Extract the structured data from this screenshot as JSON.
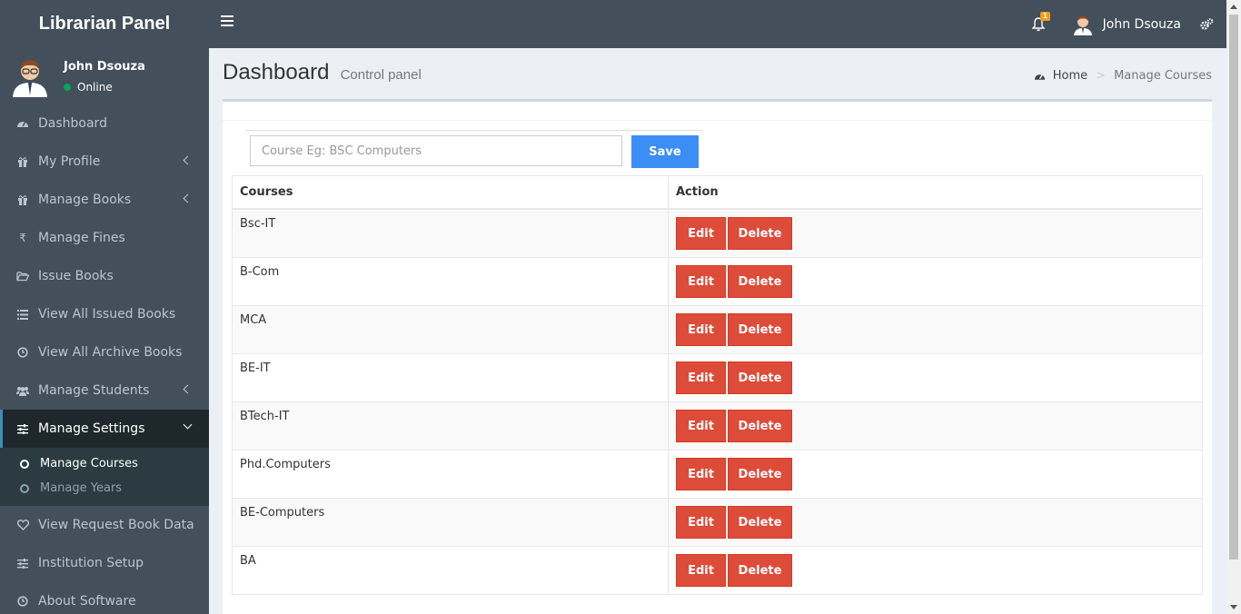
{
  "app": {
    "title": "Librarian Panel"
  },
  "header": {
    "notification_count": "1",
    "user_name": "John Dsouza"
  },
  "sidebar": {
    "user": {
      "name": "John Dsouza",
      "status": "Online"
    },
    "items": [
      {
        "label": "Dashboard",
        "icon": "dashboard-icon"
      },
      {
        "label": "My Profile",
        "icon": "gift-icon"
      },
      {
        "label": "Manage Books",
        "icon": "gift-icon"
      },
      {
        "label": "Manage Fines",
        "icon": "rupee-icon"
      },
      {
        "label": "Issue Books",
        "icon": "folder-open-icon"
      },
      {
        "label": "View All Issued Books",
        "icon": "list-icon"
      },
      {
        "label": "View All Archive Books",
        "icon": "clock-icon"
      },
      {
        "label": "Manage Students",
        "icon": "users-icon"
      },
      {
        "label": "Manage Settings",
        "icon": "sliders-icon"
      },
      {
        "label": "View Request Book Data",
        "icon": "heart-icon"
      },
      {
        "label": "Institution Setup",
        "icon": "sliders-icon"
      },
      {
        "label": "About Software",
        "icon": "clock-icon"
      }
    ],
    "settings_sub": [
      {
        "label": "Manage Courses"
      },
      {
        "label": "Manage Years"
      }
    ]
  },
  "page": {
    "title": "Dashboard",
    "subtitle": "Control panel"
  },
  "breadcrumb": {
    "home": "Home",
    "separator": ">",
    "current": "Manage Courses"
  },
  "form": {
    "course_placeholder": "Course Eg: BSC Computers",
    "save_label": "Save"
  },
  "table": {
    "headers": [
      "Courses",
      "Action"
    ],
    "edit_label": "Edit",
    "delete_label": "Delete",
    "rows": [
      "Bsc-IT",
      "B-Com",
      "MCA",
      "BE-IT",
      "BTech-IT",
      "Phd.Computers",
      "BE-Computers",
      "BA"
    ]
  },
  "colors": {
    "header_bg": "#434f5a",
    "save_button": "#3b8ef5",
    "danger_button": "#dd4b39",
    "online": "#00a65a"
  }
}
